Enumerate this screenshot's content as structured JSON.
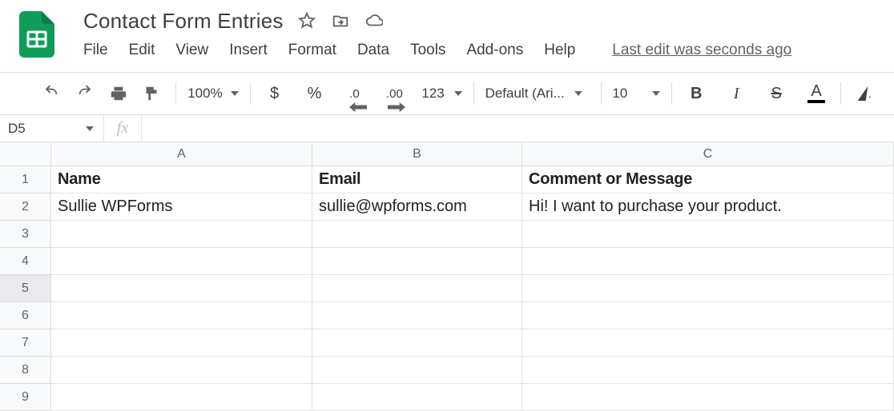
{
  "doc": {
    "title": "Contact Form Entries"
  },
  "menu": {
    "file": "File",
    "edit": "Edit",
    "view": "View",
    "insert": "Insert",
    "format": "Format",
    "data": "Data",
    "tools": "Tools",
    "addons": "Add-ons",
    "help": "Help",
    "last_edit": "Last edit was seconds ago"
  },
  "toolbar": {
    "zoom": "100%",
    "currency": "$",
    "percent": "%",
    "dec_dec": ".0",
    "inc_dec": ".00",
    "numfmt": "123",
    "font": "Default (Ari...",
    "fontsize": "10",
    "bold": "B",
    "italic": "I",
    "strike": "S",
    "textcolor": "A"
  },
  "namebox": {
    "ref": "D5"
  },
  "formula": {
    "fx": "fx",
    "value": ""
  },
  "columns": {
    "A": "A",
    "B": "B",
    "C": "C"
  },
  "rows": {
    "r1": "1",
    "r2": "2",
    "r3": "3",
    "r4": "4",
    "r5": "5",
    "r6": "6",
    "r7": "7",
    "r8": "8",
    "r9": "9"
  },
  "sheet": {
    "headers": {
      "A": "Name",
      "B": "Email",
      "C": "Comment or Message"
    },
    "row2": {
      "A": "Sullie WPForms",
      "B": "sullie@wpforms.com",
      "C": "Hi! I want to purchase your product."
    }
  }
}
